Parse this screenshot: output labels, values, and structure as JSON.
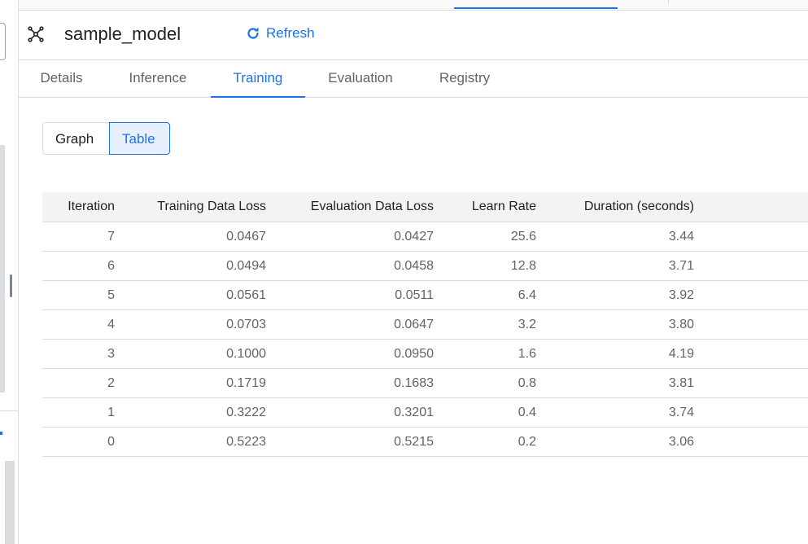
{
  "header": {
    "model_name": "sample_model",
    "refresh_label": "Refresh"
  },
  "tabs": [
    {
      "label": "Details"
    },
    {
      "label": "Inference"
    },
    {
      "label": "Training"
    },
    {
      "label": "Evaluation"
    },
    {
      "label": "Registry"
    }
  ],
  "active_tab": "Training",
  "view_toggle": {
    "graph_label": "Graph",
    "table_label": "Table",
    "selected": "Table"
  },
  "table": {
    "columns": [
      "Iteration",
      "Training Data Loss",
      "Evaluation Data Loss",
      "Learn Rate",
      "Duration (seconds)"
    ],
    "rows": [
      [
        "7",
        "0.0467",
        "0.0427",
        "25.6",
        "3.44"
      ],
      [
        "6",
        "0.0494",
        "0.0458",
        "12.8",
        "3.71"
      ],
      [
        "5",
        "0.0561",
        "0.0511",
        "6.4",
        "3.92"
      ],
      [
        "4",
        "0.0703",
        "0.0647",
        "3.2",
        "3.80"
      ],
      [
        "3",
        "0.1000",
        "0.0950",
        "1.6",
        "4.19"
      ],
      [
        "2",
        "0.1719",
        "0.1683",
        "0.8",
        "3.81"
      ],
      [
        "1",
        "0.3222",
        "0.3201",
        "0.4",
        "3.74"
      ],
      [
        "0",
        "0.5223",
        "0.5215",
        "0.2",
        "3.06"
      ]
    ]
  },
  "colors": {
    "accent": "#1a73e8",
    "header_bg": "#f1f3f4",
    "divider": "#dadce0"
  },
  "icons": {
    "model": "model-hub-icon",
    "refresh": "refresh-icon"
  }
}
